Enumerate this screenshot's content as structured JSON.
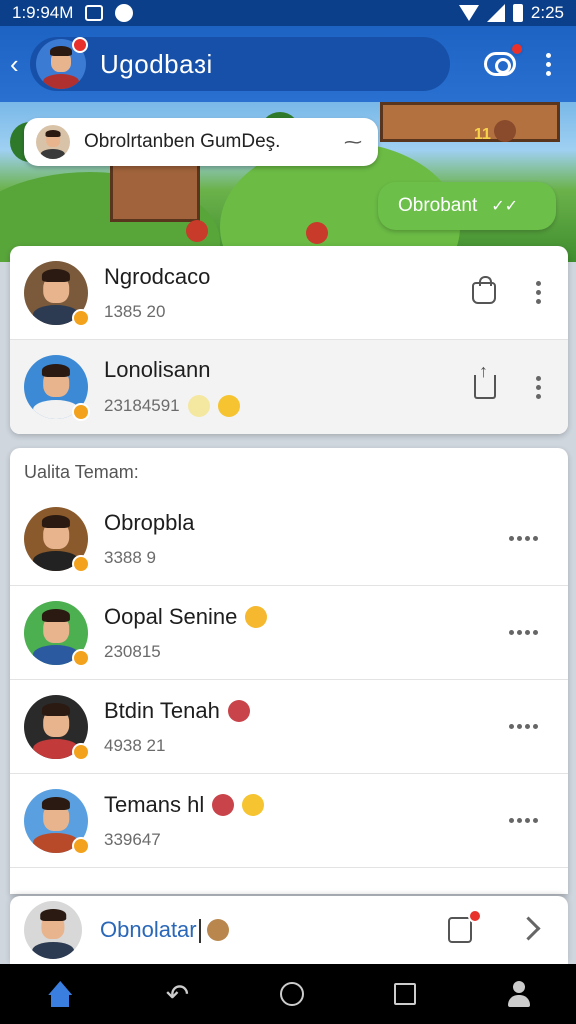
{
  "status_bar": {
    "time_left": "1:9:94M",
    "time_right": "2:25"
  },
  "header": {
    "title": "Ugodbaɜi"
  },
  "chat": {
    "incoming_message": "Obrolrtanben GumDeş.",
    "outgoing_message": "Obrobant",
    "game_hud": "11"
  },
  "pinned": [
    {
      "name": "Ngrodcaco",
      "sub": "1385 20",
      "action_icon": "bag-icon"
    },
    {
      "name": "Lonolisann",
      "sub": "23184591",
      "action_icon": "share-icon"
    }
  ],
  "section": {
    "title": "Ualita Temam:"
  },
  "contacts": [
    {
      "name": "Obropbla",
      "sub": "3388 9"
    },
    {
      "name": "Oopal Senine",
      "sub": "230815"
    },
    {
      "name": "Btdin Tenah",
      "sub": "4938 21"
    },
    {
      "name": "Temans hl",
      "sub": "339647"
    }
  ],
  "compose": {
    "text": "Obnolatar"
  },
  "colors": {
    "header": "#1d63c4",
    "status_bar": "#0b3f8a",
    "outgoing_bubble": "#6cc04a",
    "compose_text": "#2a67b8",
    "badge": "#f3a21d",
    "notification_dot": "#e8312b"
  }
}
